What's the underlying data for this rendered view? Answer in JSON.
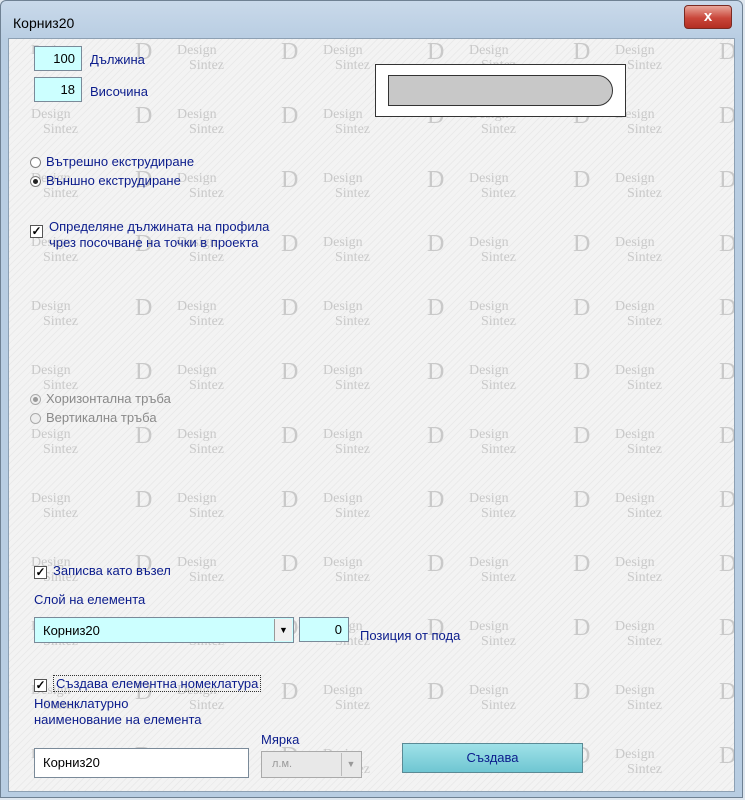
{
  "window": {
    "title": "Корниз20",
    "close_glyph": "x"
  },
  "dimensions": {
    "length_value": "100",
    "length_label": "Дължина",
    "height_value": "18",
    "height_label": "Височина"
  },
  "extrusion": {
    "inner_label": "Вътрешно екструдиране",
    "outer_label": "Външно екструдиране",
    "selected": "outer"
  },
  "define_length": {
    "checked": true,
    "label_line1": "Определяне дължината на профила",
    "label_line2": "чрез посочване на точки в проекта"
  },
  "pipe": {
    "horizontal_label": "Хоризонтална тръба",
    "vertical_label": "Вертикална тръба",
    "selected": "horizontal",
    "enabled": false
  },
  "save_as_node": {
    "checked": true,
    "label": "Записва като възел"
  },
  "layer": {
    "label": "Слой на елемента",
    "value": "Корниз20"
  },
  "floor_position": {
    "value": "0",
    "label": "Позиция от пода"
  },
  "nomenclature": {
    "checked": true,
    "label": "Създава елементна номеклатура",
    "name_label_line1": "Номенклатурно",
    "name_label_line2": "наименование на елемента",
    "name_value": "Корниз20",
    "unit_label": "Мярка",
    "unit_value": "л.м."
  },
  "create_button": {
    "label": "Създава"
  },
  "watermark": {
    "letter": "D",
    "word1": "Design",
    "word2": "Sintez"
  },
  "icons": {
    "close": "close-icon",
    "dropdown": "chevron-down-icon"
  }
}
